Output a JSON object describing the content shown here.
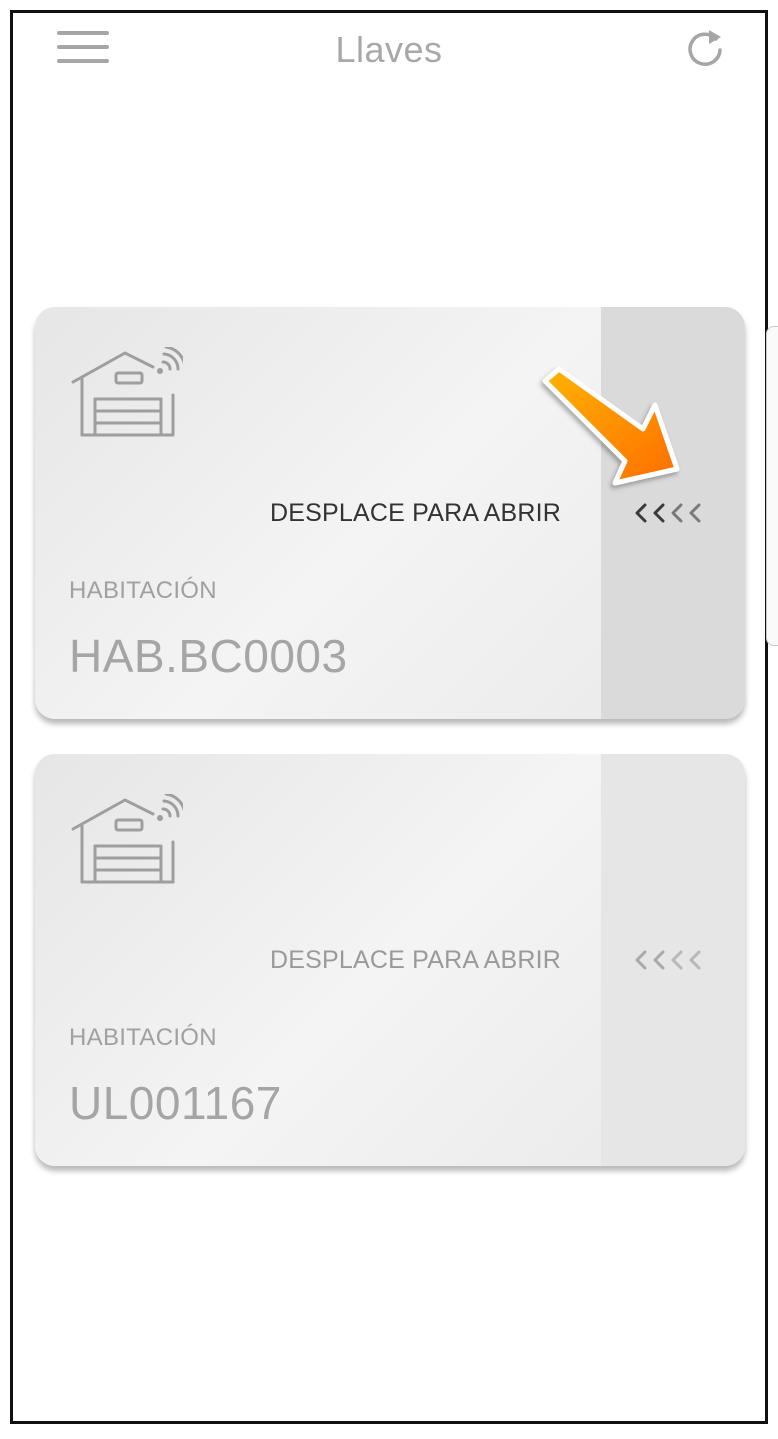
{
  "header": {
    "title": "Llaves",
    "menu_icon": "hamburger-menu-icon",
    "refresh_icon": "refresh-icon"
  },
  "cards": [
    {
      "icon": "garage-remote-icon",
      "swipe_hint": "DESPLACE PARA ABRIR",
      "chevrons": "<<<<",
      "room_label": "HABITACIÓN",
      "room_value": "HAB.BC0003",
      "highlighted": true
    },
    {
      "icon": "garage-remote-icon",
      "swipe_hint": "DESPLACE PARA ABRIR",
      "chevrons": "<<<<",
      "room_label": "HABITACIÓN",
      "room_value": "UL001167",
      "highlighted": false
    }
  ],
  "annotation": {
    "icon": "orange-arrow-icon",
    "colors": [
      "#ffb300",
      "#ff6d00"
    ]
  },
  "colors": {
    "header_text": "#a8a8a8",
    "card_bg": "#eeeeee",
    "handle_active": "#dadada",
    "handle_inactive": "#e6e6e6",
    "hint_active": "#333333",
    "hint_inactive": "#9a9a9a"
  }
}
